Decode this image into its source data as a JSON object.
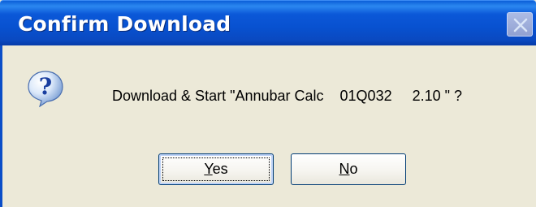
{
  "window": {
    "title": "Confirm Download"
  },
  "icon": {
    "name": "question-icon"
  },
  "message": {
    "text": "Download & Start \"Annubar Calc    01Q032     2.10 \" ?"
  },
  "buttons": {
    "yes": {
      "accel": "Y",
      "rest": "es"
    },
    "no": {
      "accel": "N",
      "rest": "o"
    }
  },
  "colors": {
    "titlebar": "#0851D0",
    "dialog_bg": "#ECE9D8",
    "button_border": "#003C74"
  }
}
